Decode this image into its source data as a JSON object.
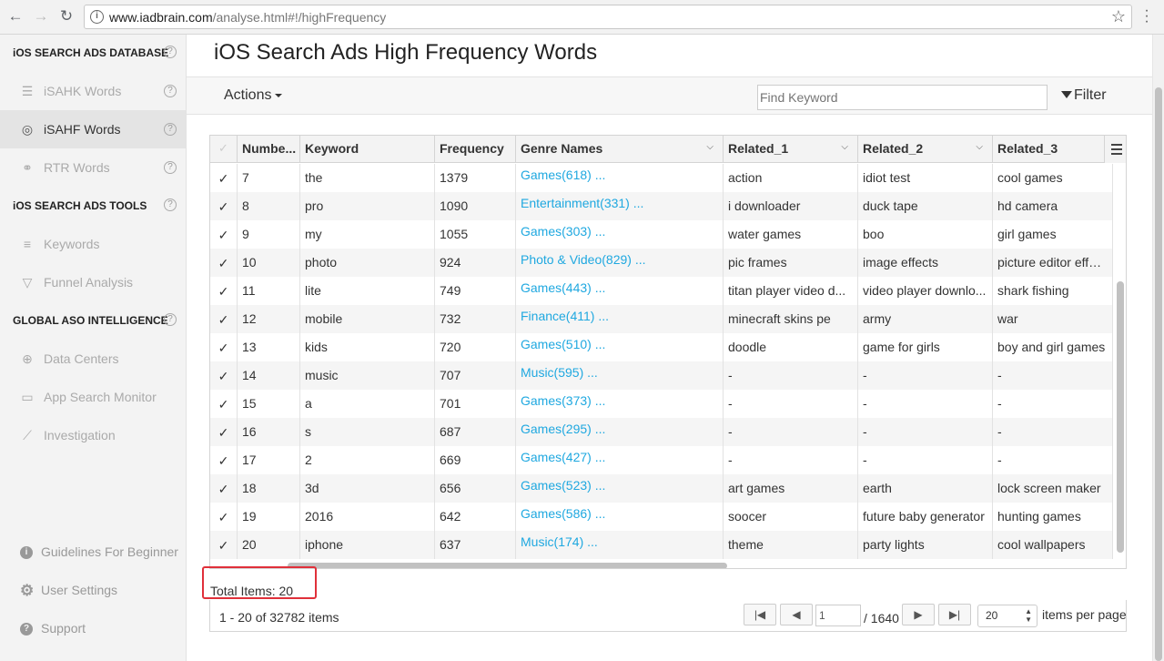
{
  "browser": {
    "url_host": "www.iadbrain.com",
    "url_path": "/analyse.html#!/highFrequency"
  },
  "sidebar": {
    "sections": [
      {
        "title": "iOS SEARCH ADS DATABASE"
      },
      {
        "title": "iOS SEARCH ADS TOOLS"
      },
      {
        "title": "GLOBAL ASO INTELLIGENCE"
      }
    ],
    "items": [
      {
        "label": "iSAHK Words",
        "icon": "search-list-icon"
      },
      {
        "label": "iSAHF Words",
        "icon": "target-icon"
      },
      {
        "label": "RTR Words",
        "icon": "link-icon"
      },
      {
        "label": "Keywords",
        "icon": "list-icon"
      },
      {
        "label": "Funnel Analysis",
        "icon": "funnel-icon"
      },
      {
        "label": "Data Centers",
        "icon": "globe-icon"
      },
      {
        "label": "App Search Monitor",
        "icon": "monitor-icon"
      },
      {
        "label": "Investigation",
        "icon": "chart-icon"
      }
    ],
    "bottom": [
      {
        "label": "Guidelines For Beginner",
        "icon": "info-icon"
      },
      {
        "label": "User Settings",
        "icon": "gear-icon"
      },
      {
        "label": "Support",
        "icon": "question-icon"
      }
    ],
    "help_glyph": "?"
  },
  "main": {
    "title": "iOS Search Ads High Frequency Words",
    "actions_label": "Actions",
    "find_placeholder": "Find Keyword",
    "filter_label": "Filter"
  },
  "grid": {
    "columns": [
      "Numbe...",
      "Keyword",
      "Frequency",
      "Genre Names",
      "Related_1",
      "Related_2",
      "Related_3"
    ],
    "rows": [
      [
        "7",
        "the",
        "1379",
        "Games(618) ...",
        "action",
        "idiot test",
        "cool games"
      ],
      [
        "8",
        "pro",
        "1090",
        "Entertainment(331) ...",
        "i downloader",
        "duck tape",
        "hd camera"
      ],
      [
        "9",
        "my",
        "1055",
        "Games(303) ...",
        "water games",
        "boo",
        "girl games"
      ],
      [
        "10",
        "photo",
        "924",
        "Photo & Video(829) ...",
        "pic frames",
        "image effects",
        "picture editor effects"
      ],
      [
        "11",
        "lite",
        "749",
        "Games(443) ...",
        "titan player video d...",
        "video player downlo...",
        "shark fishing"
      ],
      [
        "12",
        "mobile",
        "732",
        "Finance(411) ...",
        "minecraft skins pe",
        "army",
        "war"
      ],
      [
        "13",
        "kids",
        "720",
        "Games(510) ...",
        "doodle",
        "game for girls",
        "boy and girl games"
      ],
      [
        "14",
        "music",
        "707",
        "Music(595) ...",
        "-",
        "-",
        "-"
      ],
      [
        "15",
        "a",
        "701",
        "Games(373) ...",
        "-",
        "-",
        "-"
      ],
      [
        "16",
        "s",
        "687",
        "Games(295) ...",
        "-",
        "-",
        "-"
      ],
      [
        "17",
        "2",
        "669",
        "Games(427) ...",
        "-",
        "-",
        "-"
      ],
      [
        "18",
        "3d",
        "656",
        "Games(523) ...",
        "art games",
        "earth",
        "lock screen maker"
      ],
      [
        "19",
        "2016",
        "642",
        "Games(586) ...",
        "soocer",
        "future baby generator",
        "hunting games"
      ],
      [
        "20",
        "iphone",
        "637",
        "Music(174) ...",
        "theme",
        "party lights",
        "cool wallpapers"
      ]
    ],
    "total_items": "Total Items: 20"
  },
  "pager": {
    "range_text": "1 - 20 of 32782 items",
    "page_value": "1",
    "total_pages": "/ 1640",
    "page_size": "20",
    "per_page_label": "items per page"
  },
  "colors": {
    "link": "#1fa8e0",
    "highlight_box": "#e0303a"
  }
}
